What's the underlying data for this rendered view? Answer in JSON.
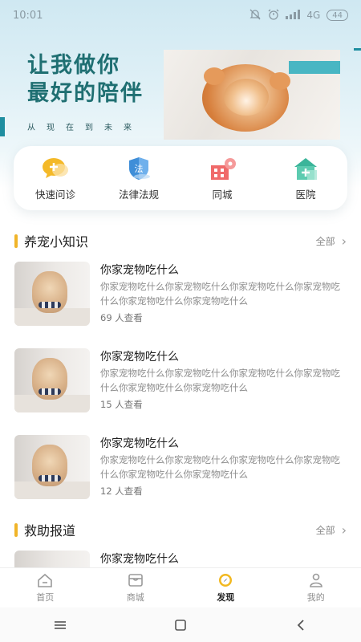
{
  "status": {
    "time": "10:01",
    "network": "4G",
    "battery": "44"
  },
  "hero": {
    "line1": "让我做你",
    "line2": "最好的陪伴",
    "tagline": "从现在到未来"
  },
  "menu": [
    {
      "label": "快速问诊",
      "icon": "chat-plus-icon"
    },
    {
      "label": "法律法规",
      "icon": "law-shield-icon",
      "badge": "法"
    },
    {
      "label": "同城",
      "icon": "city-location-icon"
    },
    {
      "label": "医院",
      "icon": "hospital-icon"
    }
  ],
  "sections": {
    "knowledge": {
      "title": "养宠小知识",
      "more": "全部"
    },
    "rescue": {
      "title": "救助报道",
      "more": "全部"
    }
  },
  "articles": [
    {
      "title": "你家宠物吃什么",
      "desc": "你家宠物吃什么你家宠物吃什么你家宠物吃什么你家宠物吃什么你家宠物吃什么你家宠物吃什么",
      "views": "69 人查看"
    },
    {
      "title": "你家宠物吃什么",
      "desc": "你家宠物吃什么你家宠物吃什么你家宠物吃什么你家宠物吃什么你家宠物吃什么你家宠物吃什么",
      "views": "15 人查看"
    },
    {
      "title": "你家宠物吃什么",
      "desc": "你家宠物吃什么你家宠物吃什么你家宠物吃什么你家宠物吃什么你家宠物吃什么你家宠物吃什么",
      "views": "12 人查看"
    }
  ],
  "rescue_articles": [
    {
      "title": "你家宠物吃什么"
    }
  ],
  "tabs": [
    {
      "label": "首页",
      "icon": "home-icon"
    },
    {
      "label": "商城",
      "icon": "store-icon"
    },
    {
      "label": "发现",
      "icon": "compass-icon",
      "active": true
    },
    {
      "label": "我的",
      "icon": "person-icon"
    }
  ],
  "colors": {
    "accent": "#f0b429",
    "teal": "#1f6f72",
    "active_tab": "#e0a800"
  }
}
